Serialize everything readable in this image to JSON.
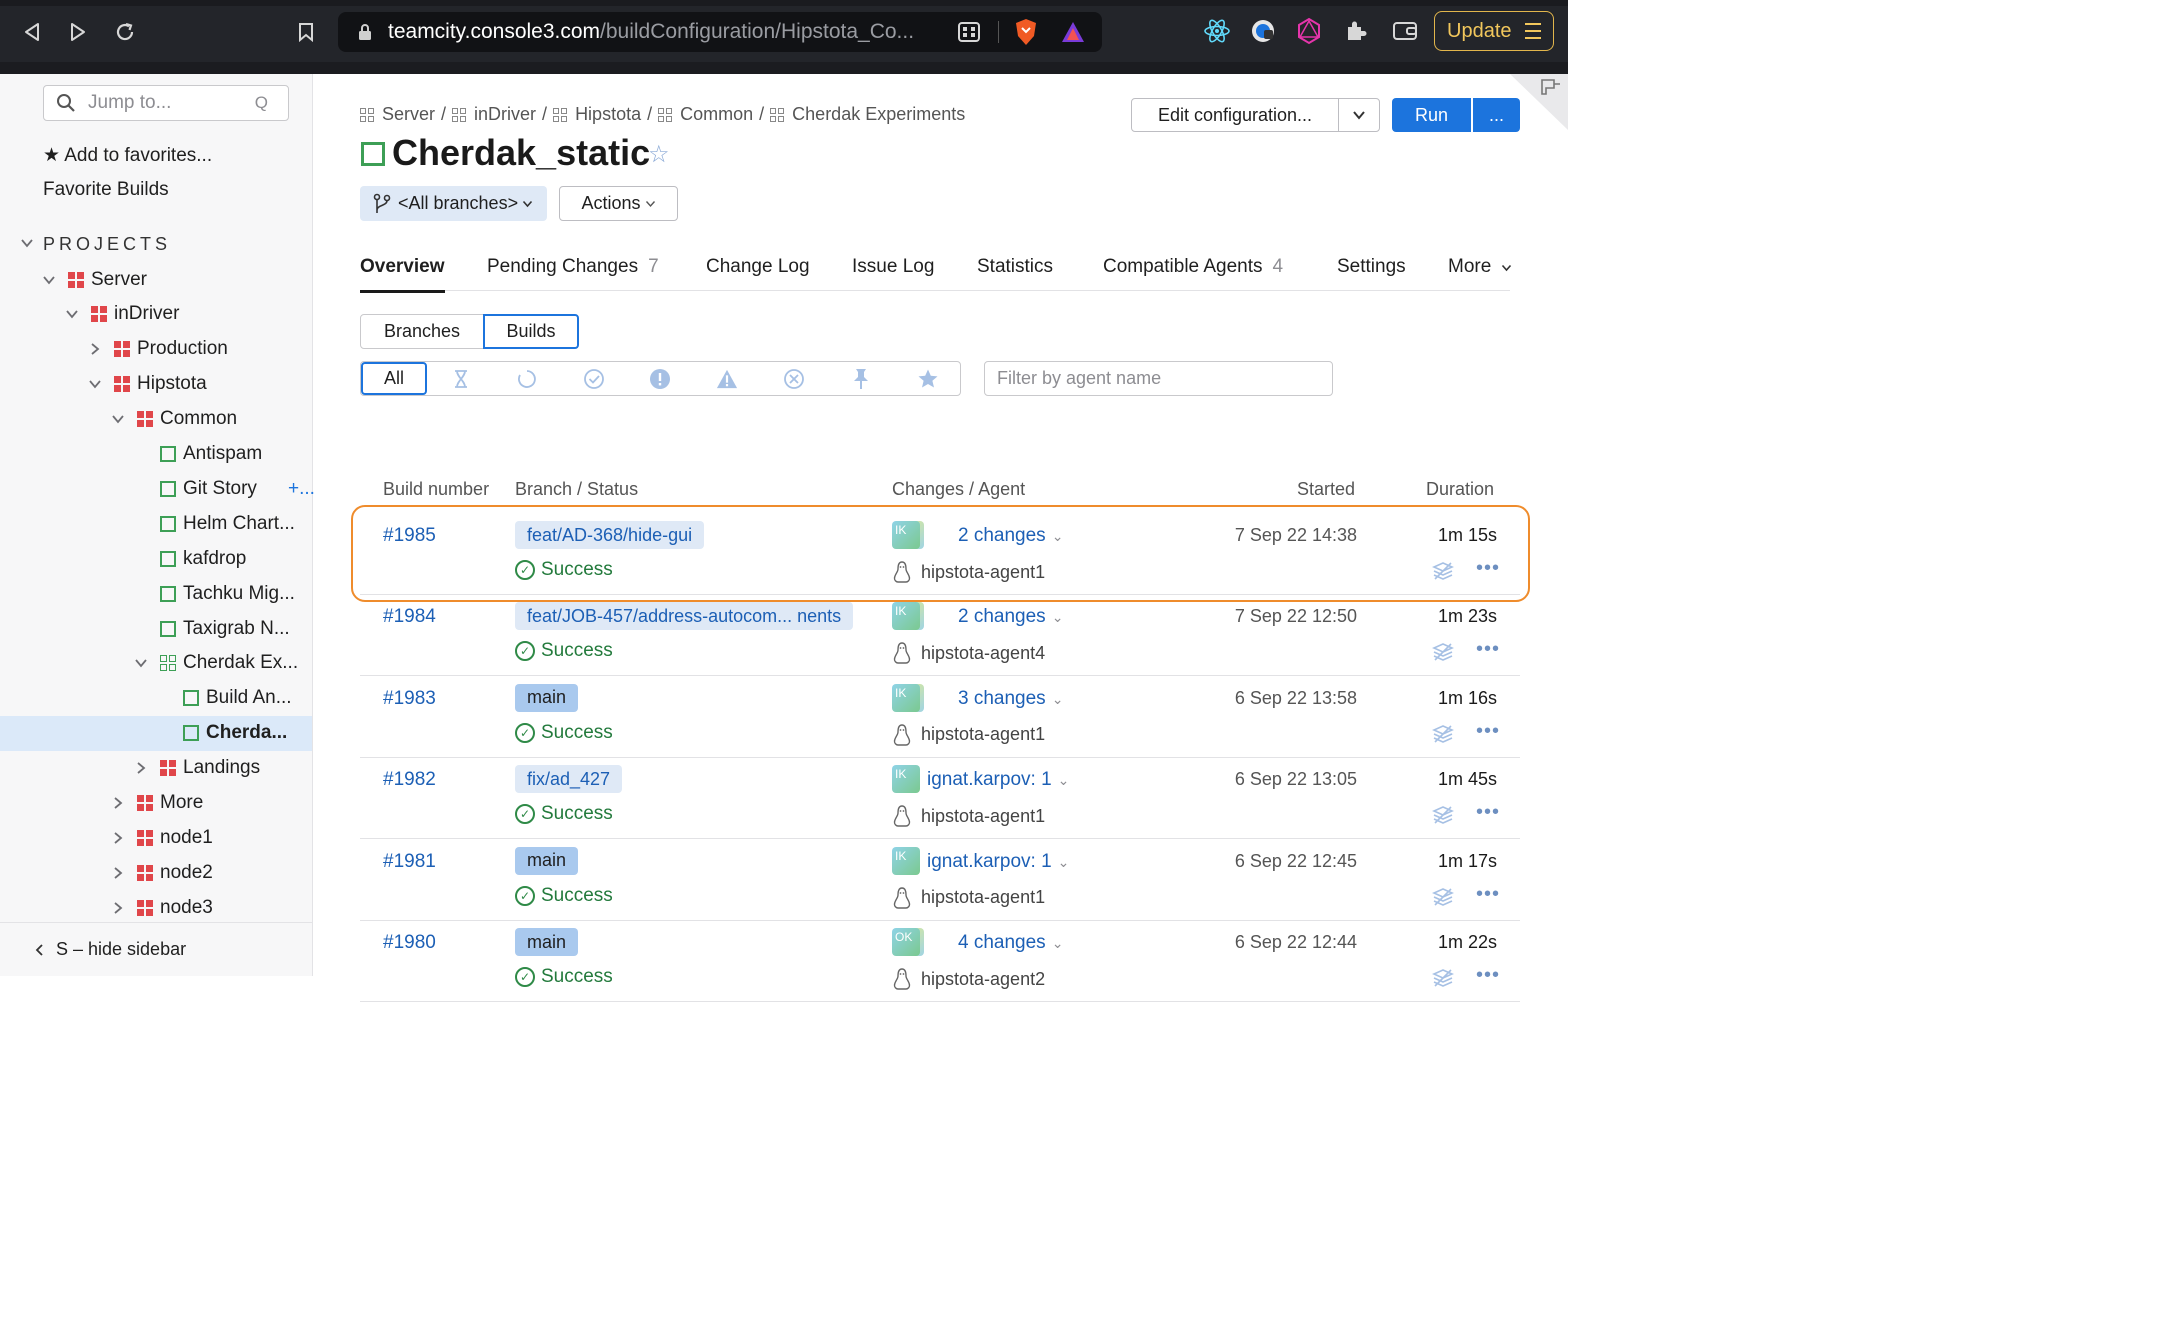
{
  "browser": {
    "url_host": "teamcity.console3.com",
    "url_path": "/buildConfiguration/Hipstota_Co...",
    "update_label": "Update"
  },
  "sidebar": {
    "search_placeholder": "Jump to...",
    "search_shortcut": "Q",
    "add_favorites": "★ Add to favorites...",
    "favorite_builds": "Favorite Builds",
    "projects_header": "PROJECTS",
    "tree": [
      {
        "label": "Server",
        "kind": "project",
        "expanded": true
      },
      {
        "label": "inDriver",
        "kind": "project",
        "expanded": true
      },
      {
        "label": "Production",
        "kind": "project",
        "expanded": false
      },
      {
        "label": "Hipstota",
        "kind": "project",
        "expanded": true
      },
      {
        "label": "Common",
        "kind": "project",
        "expanded": true
      },
      {
        "label": "Antispam",
        "kind": "config"
      },
      {
        "label": "Git Story ",
        "kind": "config",
        "extra": "+..."
      },
      {
        "label": "Helm Chart...",
        "kind": "config"
      },
      {
        "label": "kafdrop",
        "kind": "config"
      },
      {
        "label": "Tachku Mig...",
        "kind": "config"
      },
      {
        "label": "Taxigrab N...",
        "kind": "config"
      },
      {
        "label": "Cherdak Ex...",
        "kind": "group",
        "expanded": true
      },
      {
        "label": "Build An...",
        "kind": "config"
      },
      {
        "label": "Cherda...",
        "kind": "config",
        "selected": true
      },
      {
        "label": "Landings",
        "kind": "project",
        "expanded": false
      },
      {
        "label": "More",
        "kind": "project",
        "expanded": false
      },
      {
        "label": "node1",
        "kind": "project",
        "expanded": false
      },
      {
        "label": "node2",
        "kind": "project",
        "expanded": false
      },
      {
        "label": "node3",
        "kind": "project",
        "expanded": false
      }
    ],
    "hide_sidebar": "S – hide sidebar"
  },
  "breadcrumb": [
    "Server",
    "inDriver",
    "Hipstota",
    "Common",
    "Cherdak Experiments"
  ],
  "page": {
    "title": "Cherdak_static",
    "edit_config": "Edit configuration...",
    "run": "Run",
    "run_more": "...",
    "branch_selector": "<All branches>",
    "actions": "Actions"
  },
  "tabs": [
    {
      "label": "Overview",
      "count": "",
      "active": true
    },
    {
      "label": "Pending Changes",
      "count": "7"
    },
    {
      "label": "Change Log",
      "count": ""
    },
    {
      "label": "Issue Log",
      "count": ""
    },
    {
      "label": "Statistics",
      "count": ""
    },
    {
      "label": "Compatible Agents",
      "count": "4"
    },
    {
      "label": "Settings",
      "count": ""
    },
    {
      "label": "More",
      "count": ""
    }
  ],
  "view_toggle": {
    "branches": "Branches",
    "builds": "Builds",
    "selected": "Builds"
  },
  "filters": {
    "all": "All",
    "icons": [
      "queued-hourglass-icon",
      "running-spinner-icon",
      "success-check-icon",
      "failed-exclamation-icon",
      "warning-triangle-icon",
      "cancelled-x-icon",
      "pinned-pin-icon",
      "favorite-star-icon"
    ],
    "agent_placeholder": "Filter by agent name"
  },
  "table": {
    "headers": {
      "build_number": "Build number",
      "branch_status": "Branch / Status",
      "changes_agent": "Changes / Agent",
      "started": "Started",
      "duration": "Duration"
    },
    "rows": [
      {
        "number": "#1985",
        "branch": "feat/AD-368/hide-gui",
        "is_main": false,
        "status": "Success",
        "avatar": "IK",
        "changes": "2 changes",
        "agent": "hipstota-agent1",
        "started": "7 Sep 22 14:38",
        "duration": "1m 15s"
      },
      {
        "number": "#1984",
        "branch": "feat/JOB-457/address-autocom... nents",
        "is_main": false,
        "status": "Success",
        "avatar": "IK",
        "changes": "2 changes",
        "agent": "hipstota-agent4",
        "started": "7 Sep 22 12:50",
        "duration": "1m 23s"
      },
      {
        "number": "#1983",
        "branch": "main",
        "is_main": true,
        "status": "Success",
        "avatar": "IK",
        "changes": "3 changes",
        "agent": "hipstota-agent1",
        "started": "6 Sep 22 13:58",
        "duration": "1m 16s"
      },
      {
        "number": "#1982",
        "branch": "fix/ad_427",
        "is_main": false,
        "status": "Success",
        "avatar": "IK",
        "changes": "ignat.karpov: 1",
        "agent": "hipstota-agent1",
        "started": "6 Sep 22 13:05",
        "duration": "1m 45s"
      },
      {
        "number": "#1981",
        "branch": "main",
        "is_main": true,
        "status": "Success",
        "avatar": "IK",
        "changes": "ignat.karpov: 1",
        "agent": "hipstota-agent1",
        "started": "6 Sep 22 12:45",
        "duration": "1m 17s"
      },
      {
        "number": "#1980",
        "branch": "main",
        "is_main": true,
        "status": "Success",
        "avatar": "OK",
        "changes": "4 changes",
        "agent": "hipstota-agent2",
        "started": "6 Sep 22 12:44",
        "duration": "1m 22s"
      }
    ]
  },
  "colors": {
    "accent": "#1c74dd",
    "success": "#237a3c",
    "highlight": "#ef8c2c",
    "selected_bg": "#dbe9f9"
  }
}
